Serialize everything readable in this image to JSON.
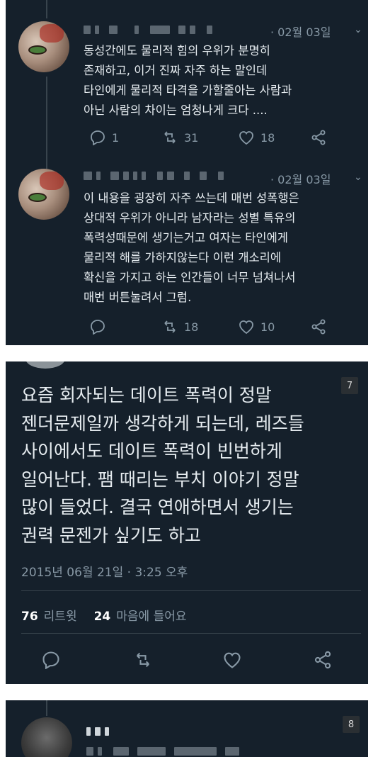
{
  "tweets": [
    {
      "date": "· 02월 03일",
      "text": "동성간에도 물리적 힘의 우위가 분명히\n존재하고, 이거 진짜 자주 하는 말인데\n타인에게 물리적 타격을 가할줄아는 사람과\n아닌 사람의 차이는 엄청나게 크다 ....",
      "reply_count": "1",
      "retweet_count": "31",
      "like_count": "18"
    },
    {
      "date": "· 02월 03일",
      "text": "이 내용을 굉장히 자주 쓰는데 매번 성폭행은\n상대적 우위가 아니라 남자라는 성별 특유의\n폭력성때문에 생기는거고 여자는 타인에게\n물리적 해를 가하지않는다 이런 개소리에\n확신을 가지고 하는 인간들이 너무 넘쳐나서\n매번 버튼눌려서 그럼.",
      "retweet_count": "18",
      "like_count": "10"
    }
  ],
  "focused_tweet": {
    "badge": "7",
    "text": "요즘 회자되는 데이트 폭력이 정말\n젠더문제일까 생각하게 되는데, 레즈들\n사이에서도 데이트 폭력이 빈번하게\n일어난다. 팸 때리는 부치 이야기 정말\n많이 들었다. 결국 연애하면서 생기는\n권력 문젠가 싶기도 하고",
    "datetime": "2015년 06월 21일 · 3:25 오후",
    "retweets_value": "76",
    "retweets_label": "리트윗",
    "likes_value": "24",
    "likes_label": "마음에 들어요"
  },
  "bottom_panel": {
    "badge": "8"
  },
  "colors": {
    "background": "#15202b",
    "text": "#e6ecf0",
    "muted": "#8899a6",
    "divider": "#38444d"
  }
}
